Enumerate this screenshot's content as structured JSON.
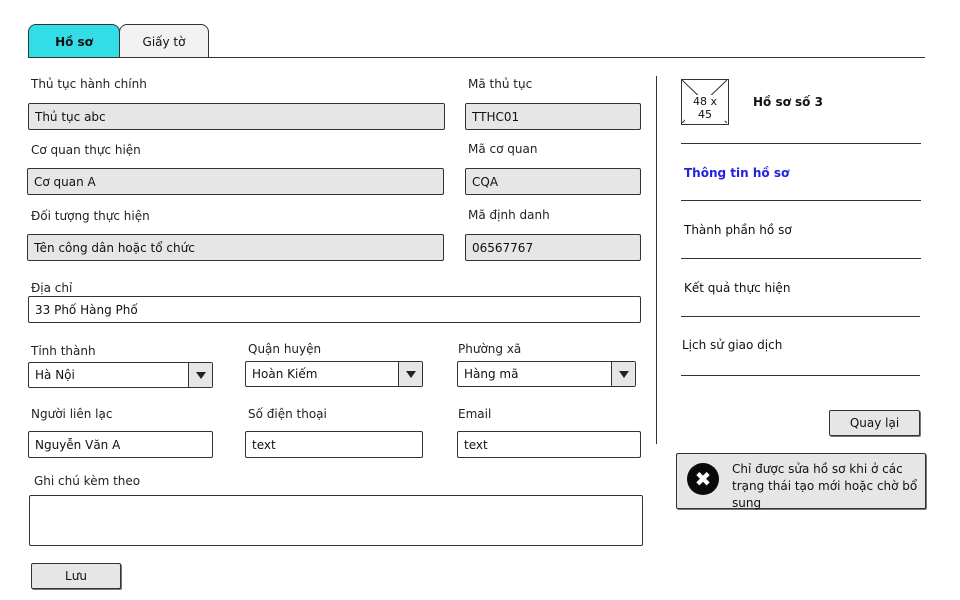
{
  "tabs": [
    {
      "label": "Hồ sơ",
      "active": true
    },
    {
      "label": "Giấy tờ",
      "active": false
    }
  ],
  "form": {
    "thu_tuc": {
      "label": "Thủ tục hành chính",
      "value": "Thủ tục abc"
    },
    "ma_thu_tuc": {
      "label": "Mã thủ tục",
      "value": "TTHC01"
    },
    "co_quan": {
      "label": "Cơ quan thực hiện",
      "value": "Cơ quan A"
    },
    "ma_co_quan": {
      "label": "Mã cơ quan",
      "value": "CQA"
    },
    "doi_tuong": {
      "label": "Đối tượng thực hiện",
      "value": "Tên công dân hoặc tổ chức"
    },
    "ma_dinh_danh": {
      "label": "Mã định danh",
      "value": "06567767"
    },
    "dia_chi": {
      "label": "Địa chỉ",
      "value": "33 Phố Hàng Phố"
    },
    "tinh_thanh": {
      "label": "Tỉnh thành",
      "value": "Hà Nội"
    },
    "quan_huyen": {
      "label": "Quận huyện",
      "value": "Hoàn Kiếm"
    },
    "phuong_xa": {
      "label": "Phường xã",
      "value": "Hàng mã"
    },
    "nguoi_lien_lac": {
      "label": "Người liên lạc",
      "value": "Nguyễn Văn A"
    },
    "so_dien_thoai": {
      "label": "Số điện thoại",
      "value": "text"
    },
    "email": {
      "label": "Email",
      "value": "text"
    },
    "ghi_chu": {
      "label": "Ghi chú kèm theo",
      "value": ""
    },
    "save_label": "Lưu"
  },
  "side": {
    "image_placeholder": "48 x 45",
    "title": "Hồ sơ số 3",
    "nav": [
      {
        "label": "Thông tin hồ sơ",
        "active": true
      },
      {
        "label": "Thành phần hồ sơ",
        "active": false
      },
      {
        "label": "Kết quả thực hiện",
        "active": false
      },
      {
        "label": "Lịch sử giao dịch",
        "active": false
      }
    ],
    "back_label": "Quay lại",
    "alert_text": "Chỉ được sửa hồ sơ khi ở các trạng thái tạo mới hoặc chờ bổ sung",
    "alert_icon": "✖"
  },
  "colors": {
    "active_tab": "#33dde8",
    "active_nav": "#2323e0",
    "readonly_bg": "#e6e6e6"
  }
}
